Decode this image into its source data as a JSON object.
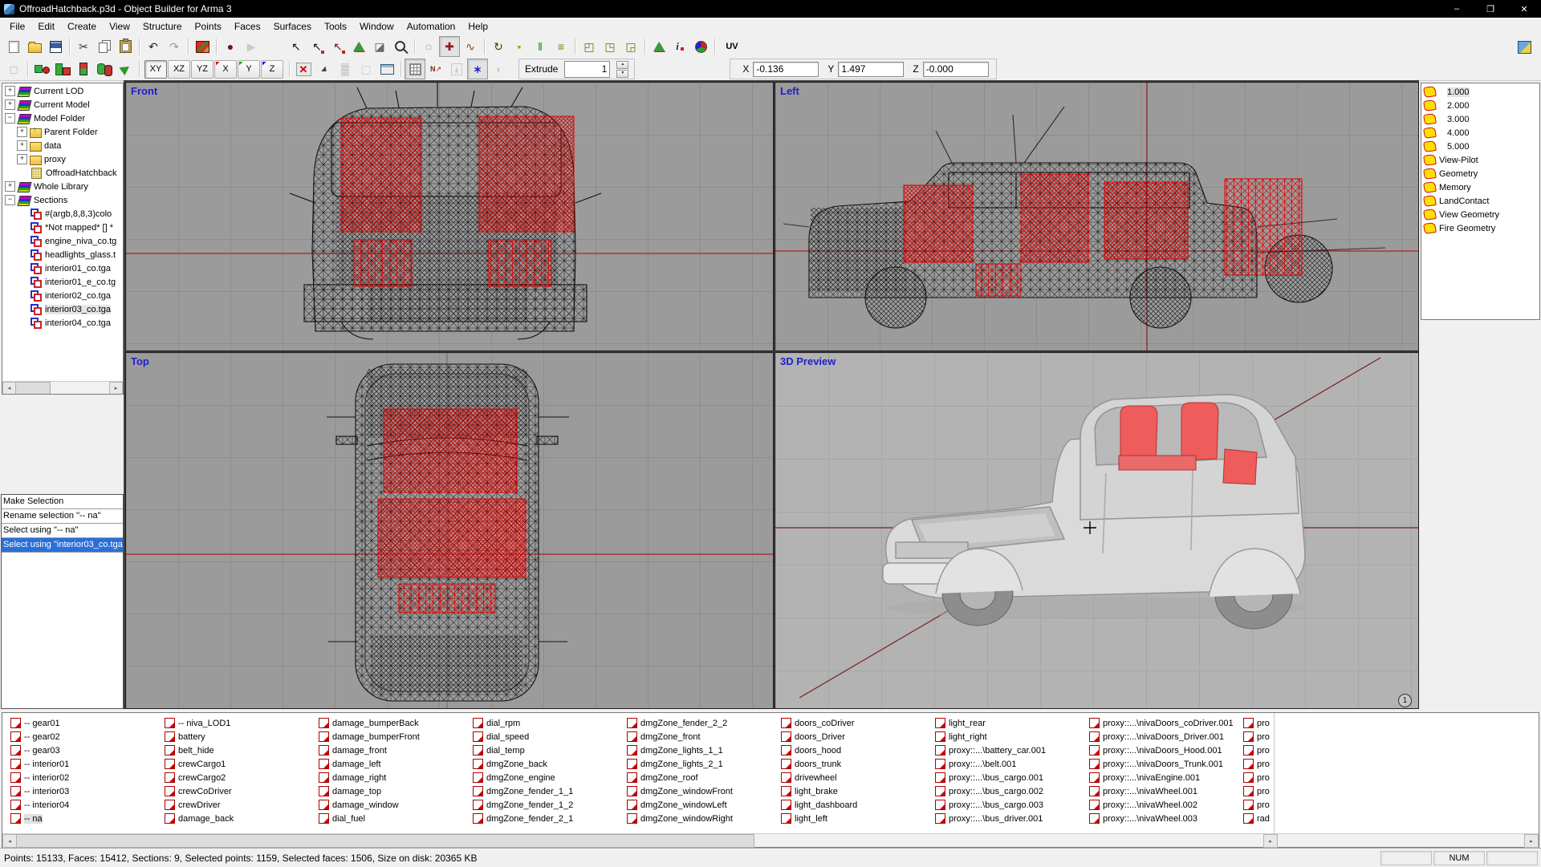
{
  "window": {
    "title": "OffroadHatchback.p3d - Object Builder for Arma 3",
    "controls": [
      {
        "name": "minimize-button",
        "glyph": "–"
      },
      {
        "name": "maximize-button",
        "glyph": "❐"
      },
      {
        "name": "close-button",
        "glyph": "✕"
      }
    ]
  },
  "menus": [
    "File",
    "Edit",
    "Create",
    "View",
    "Structure",
    "Points",
    "Faces",
    "Surfaces",
    "Tools",
    "Window",
    "Automation",
    "Help"
  ],
  "toolbar1": [
    {
      "name": "new-file-button",
      "cls": "i-doc"
    },
    {
      "name": "open-button",
      "cls": "i-folderopen"
    },
    {
      "name": "save-button",
      "cls": "i-disk"
    },
    {
      "sep": true
    },
    {
      "name": "cut-button",
      "glyph": "✂",
      "color": "#333333"
    },
    {
      "name": "copy-button",
      "cls": "i-copy"
    },
    {
      "name": "paste-button",
      "cls": "i-paste"
    },
    {
      "sep": true
    },
    {
      "name": "undo-button",
      "glyph": "↶",
      "color": "#222222"
    },
    {
      "name": "redo-button",
      "glyph": "↷",
      "color": "#222222",
      "disabled": true
    },
    {
      "sep": true
    },
    {
      "name": "reload-textures-button",
      "cls": "i-tex"
    },
    {
      "sep": true
    },
    {
      "name": "record-button",
      "glyph": "●",
      "color": "#7a1010"
    },
    {
      "name": "play-button",
      "glyph": "▶",
      "color": "#9a9a9a",
      "disabled": true
    },
    {
      "gap": true
    },
    {
      "name": "select-object-button",
      "glyph": "↖",
      "color": "#111111"
    },
    {
      "name": "select-point-button",
      "glyph": "↖",
      "color": "#111111",
      "cls": "i-badge-red"
    },
    {
      "name": "select-polygon-button",
      "glyph": "↖",
      "color": "#7a1010",
      "cls": "i-badge-red"
    },
    {
      "name": "select-texture-button",
      "cls": "i-tri"
    },
    {
      "name": "flatten-button",
      "glyph": "◪",
      "color": "#666666"
    },
    {
      "name": "zoom-button",
      "cls": "i-zoom"
    },
    {
      "sep": true
    },
    {
      "name": "circle-select-button",
      "glyph": "◌",
      "color": "#555555"
    },
    {
      "name": "move-button",
      "glyph": "✚",
      "color": "#8b1a1a",
      "active": true
    },
    {
      "name": "soft-path-button",
      "glyph": "∿",
      "color": "#884400"
    },
    {
      "sep": true
    },
    {
      "name": "rotate-button",
      "glyph": "↻",
      "color": "#553300"
    },
    {
      "name": "vertex-button",
      "glyph": "▪",
      "color": "#b8a000"
    },
    {
      "name": "mirror-button",
      "glyph": "‖",
      "color": "#0a8a0a"
    },
    {
      "name": "level-button",
      "glyph": "≡",
      "color": "#7a7a00"
    },
    {
      "sep": true
    },
    {
      "name": "box-move-button",
      "glyph": "◰",
      "color": "#7a6a00"
    },
    {
      "name": "box-rotate-button",
      "glyph": "◳",
      "color": "#7a6a00"
    },
    {
      "name": "box-scale-button",
      "glyph": "◲",
      "color": "#7a6a00"
    },
    {
      "sep": true
    },
    {
      "name": "triangle-info-button",
      "cls": "i-tri2"
    },
    {
      "name": "point-info-button",
      "cls": "i-infov"
    },
    {
      "name": "colorize-button",
      "cls": "i-rgb"
    },
    {
      "sep": true
    },
    {
      "name": "uv-editor-button",
      "glyph": "UV",
      "color": "#000000",
      "cls": "txt"
    }
  ],
  "toolbar1_right": [
    {
      "name": "bulldozer-button",
      "cls": "i-bull"
    }
  ],
  "toolbar2a": [
    {
      "name": "view-box-button",
      "glyph": "◻",
      "color": "#888888",
      "disabled": true
    },
    {
      "sep": true
    },
    {
      "name": "create-point-button",
      "cls": "i-sqdot"
    },
    {
      "name": "create-bars-button",
      "cls": "i-bars"
    },
    {
      "name": "create-column-button",
      "cls": "i-bar2"
    },
    {
      "name": "create-cylinder-button",
      "cls": "i-cyl"
    },
    {
      "name": "export-selection-button",
      "cls": "i-flag"
    },
    {
      "sep": true
    }
  ],
  "plane_buttons": [
    {
      "name": "plane-xy-button",
      "label": "XY",
      "active": true
    },
    {
      "name": "plane-xz-button",
      "label": "XZ"
    },
    {
      "name": "plane-yz-button",
      "label": "YZ"
    },
    {
      "name": "axis-x-button",
      "label": "X",
      "mark": "#dd0000"
    },
    {
      "name": "axis-y-button",
      "label": "Y",
      "mark": "#00aa00"
    },
    {
      "name": "axis-z-button",
      "label": "Z",
      "mark": "#0000dd"
    }
  ],
  "toolbar2b": [
    {
      "sep": true
    },
    {
      "name": "hide-selection-button",
      "cls": "i-delx"
    },
    {
      "name": "sharp-edge-button",
      "cls": "i-sharp"
    },
    {
      "name": "weld-button",
      "glyph": "▒",
      "color": "#888888"
    },
    {
      "name": "shadow-box-button",
      "glyph": "▢",
      "color": "#999999",
      "disabled": true
    },
    {
      "name": "properties-button",
      "cls": "i-dlg"
    },
    {
      "sep": true
    },
    {
      "name": "grid-toggle-button",
      "cls": "i-gridic",
      "active": true
    },
    {
      "name": "normals-button",
      "cls": "i-norm"
    },
    {
      "name": "animation-button",
      "cls": "i-run",
      "disabled": true
    },
    {
      "name": "knot-button",
      "glyph": "∗",
      "color": "#0000cc",
      "active": true
    },
    {
      "name": "cap-button",
      "glyph": "◗",
      "color": "#999999",
      "disabled": true
    }
  ],
  "extrude": {
    "label": "Extrude",
    "value": "1",
    "up": "▲",
    "down": "▼"
  },
  "coords": {
    "x_label": "X",
    "x_value": "-0.136",
    "y_label": "Y",
    "y_value": "1.497",
    "z_label": "Z",
    "z_value": "-0.000"
  },
  "tree": [
    {
      "expand": "+",
      "icon": "books",
      "label": "Current LOD",
      "indent": 0
    },
    {
      "expand": "+",
      "icon": "books",
      "label": "Current Model",
      "indent": 0
    },
    {
      "expand": "−",
      "icon": "books",
      "label": "Model Folder",
      "indent": 0
    },
    {
      "expand": "+",
      "icon": "folder-up",
      "label": "Parent Folder",
      "indent": 1
    },
    {
      "expand": "+",
      "icon": "folder",
      "label": "data",
      "indent": 1
    },
    {
      "expand": "+",
      "icon": "folder",
      "label": "proxy",
      "indent": 1
    },
    {
      "icon": "page",
      "label": "OffroadHatchback",
      "indent": 1
    },
    {
      "expand": "+",
      "icon": "books",
      "label": "Whole Library",
      "indent": 0
    },
    {
      "expand": "−",
      "icon": "books",
      "label": "Sections",
      "indent": 0
    },
    {
      "icon": "section",
      "label": "#(argb,8,8,3)colo",
      "indent": 1
    },
    {
      "icon": "section",
      "label": "*Not mapped* [] *",
      "indent": 1
    },
    {
      "icon": "section",
      "label": "engine_niva_co.tg",
      "indent": 1
    },
    {
      "icon": "section",
      "label": "headlights_glass.t",
      "indent": 1
    },
    {
      "icon": "section",
      "label": "interior01_co.tga",
      "indent": 1
    },
    {
      "icon": "section",
      "label": "interior01_e_co.tg",
      "indent": 1
    },
    {
      "icon": "section",
      "label": "interior02_co.tga",
      "indent": 1
    },
    {
      "icon": "section",
      "label": "interior03_co.tga",
      "indent": 1,
      "selected": true
    },
    {
      "icon": "section",
      "label": "interior04_co.tga",
      "indent": 1
    }
  ],
  "tree_scroll": {
    "left": "◂",
    "right": "▸"
  },
  "selection_actions": [
    {
      "label": "Make Selection"
    },
    {
      "label": "Rename selection \"-- na\""
    },
    {
      "label": "Select using \"-- na\""
    },
    {
      "label": "Select using \"interior03_co.tga",
      "selected": true
    }
  ],
  "viewports": {
    "front": {
      "label": "Front"
    },
    "left": {
      "label": "Left"
    },
    "top": {
      "label": "Top"
    },
    "preview": {
      "label": "3D Preview",
      "badge": "1"
    }
  },
  "lods": [
    {
      "label": "1.000",
      "num": true,
      "selected": true
    },
    {
      "label": "2.000",
      "num": true
    },
    {
      "label": "3.000",
      "num": true
    },
    {
      "label": "4.000",
      "num": true
    },
    {
      "label": "5.000",
      "num": true
    },
    {
      "label": "View-Pilot"
    },
    {
      "label": "Geometry"
    },
    {
      "label": "Memory"
    },
    {
      "label": "LandContact"
    },
    {
      "label": "View Geometry"
    },
    {
      "label": "Fire Geometry"
    }
  ],
  "named_selections": {
    "columns": [
      {
        "items": [
          {
            "label": "-- gear01"
          },
          {
            "label": "-- gear02"
          },
          {
            "label": "-- gear03"
          },
          {
            "label": "-- interior01"
          },
          {
            "label": "-- interior02"
          },
          {
            "label": "-- interior03"
          },
          {
            "label": "-- interior04"
          },
          {
            "label": "-- na",
            "selected": true
          }
        ]
      },
      {
        "items": [
          "-- niva_LOD1",
          "battery",
          "belt_hide",
          "crewCargo1",
          "crewCargo2",
          "crewCoDriver",
          "crewDriver",
          "damage_back"
        ]
      },
      {
        "items": [
          "damage_bumperBack",
          "damage_bumperFront",
          "damage_front",
          "damage_left",
          "damage_right",
          "damage_top",
          "damage_window",
          "dial_fuel"
        ]
      },
      {
        "items": [
          "dial_rpm",
          "dial_speed",
          "dial_temp",
          "dmgZone_back",
          "dmgZone_engine",
          "dmgZone_fender_1_1",
          "dmgZone_fender_1_2",
          "dmgZone_fender_2_1"
        ]
      },
      {
        "items": [
          "dmgZone_fender_2_2",
          "dmgZone_front",
          "dmgZone_lights_1_1",
          "dmgZone_lights_2_1",
          "dmgZone_roof",
          "dmgZone_windowFront",
          "dmgZone_windowLeft",
          "dmgZone_windowRight"
        ]
      },
      {
        "items": [
          "doors_coDriver",
          "doors_Driver",
          "doors_hood",
          "doors_trunk",
          "drivewheel",
          "light_brake",
          "light_dashboard",
          "light_left"
        ]
      },
      {
        "items": [
          "light_rear",
          "light_right",
          "proxy::...\\battery_car.001",
          "proxy::...\\belt.001",
          "proxy::...\\bus_cargo.001",
          "proxy::...\\bus_cargo.002",
          "proxy::...\\bus_cargo.003",
          "proxy::...\\bus_driver.001"
        ]
      },
      {
        "items": [
          "proxy::...\\nivaDoors_coDriver.001",
          "proxy::...\\nivaDoors_Driver.001",
          "proxy::...\\nivaDoors_Hood.001",
          "proxy::...\\nivaDoors_Trunk.001",
          "proxy::...\\nivaEngine.001",
          "proxy::...\\nivaWheel.001",
          "proxy::...\\nivaWheel.002",
          "proxy::...\\nivaWheel.003"
        ]
      },
      {
        "items": [
          "pro",
          "pro",
          "pro",
          "pro",
          "pro",
          "pro",
          "pro",
          "rad"
        ]
      }
    ]
  },
  "bottom_scroll": {
    "left": "◂",
    "right": "▸"
  },
  "status": {
    "text": "Points: 15133, Faces: 15412, Sections: 9, Selected points: 1159, Selected faces: 1506, Size on disk: 20365 KB",
    "cells": [
      "",
      "NUM",
      ""
    ]
  }
}
